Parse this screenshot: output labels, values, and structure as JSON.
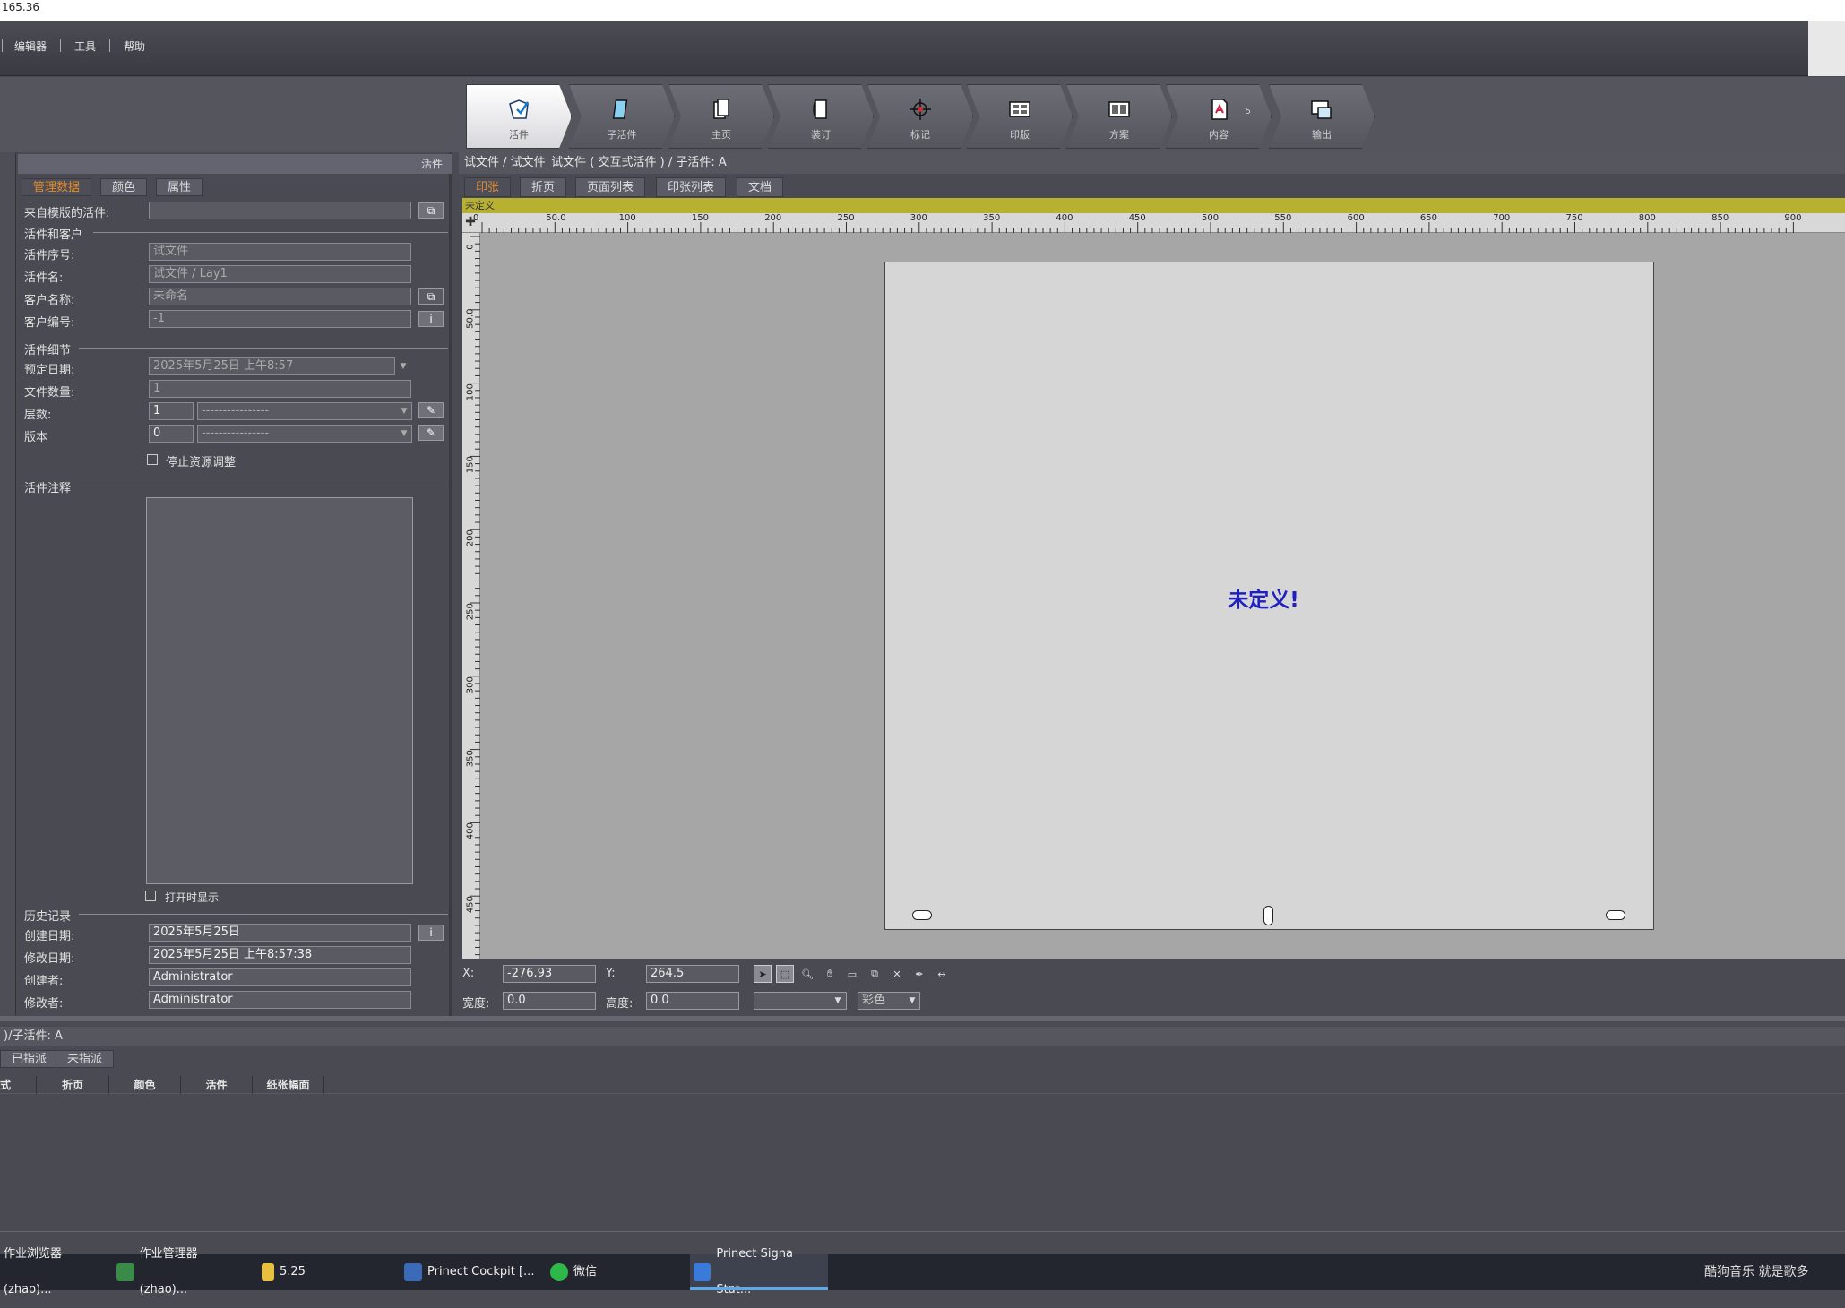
{
  "titlebar": {
    "text": "165.36"
  },
  "menu": {
    "items": [
      "编辑器",
      "工具",
      "帮助"
    ]
  },
  "toolbar": {
    "tabs": [
      {
        "label": "活件",
        "icon": "job-icon",
        "active": true
      },
      {
        "label": "子活件",
        "icon": "subjob-icon"
      },
      {
        "label": "主页",
        "icon": "master-pages-icon"
      },
      {
        "label": "装订",
        "icon": "binding-icon"
      },
      {
        "label": "标记",
        "icon": "marks-icon"
      },
      {
        "label": "印版",
        "icon": "plate-icon"
      },
      {
        "label": "方案",
        "icon": "layout-icon"
      },
      {
        "label": "内容",
        "icon": "content-icon",
        "badge": "5"
      },
      {
        "label": "输出",
        "icon": "output-icon"
      }
    ]
  },
  "left_panel": {
    "header": "活件",
    "tabs": [
      "管理数据",
      "颜色",
      "属性"
    ],
    "from_template_label": "来自模版的活件:",
    "from_template_value": "",
    "section_job_customer": "活件和客户",
    "job_no_label": "活件序号:",
    "job_no_value": "试文件",
    "job_name_label": "活件名:",
    "job_name_value": "试文件 / Lay1",
    "customer_name_label": "客户名称:",
    "customer_name_value": "未命名",
    "customer_no_label": "客户编号:",
    "customer_no_value": "-1",
    "section_details": "活件细节",
    "due_date_label": "预定日期:",
    "due_date_value": "2025年5月25日 上午8:57",
    "file_count_label": "文件数量:",
    "file_count_value": "1",
    "layers_label": "层数:",
    "layers_value": "1",
    "layers_select": "----------------",
    "version_label": "版本",
    "version_value": "0",
    "version_select": "----------------",
    "stop_resource_label": "停止资源调整",
    "section_notes": "活件注释",
    "show_on_open_label": "打开时显示",
    "section_history": "历史记录",
    "created_label": "创建日期:",
    "created_value": "2025年5月25日",
    "modified_label": "修改日期:",
    "modified_value": "2025年5月25日   上午8:57:38",
    "creator_label": "创建者:",
    "creator_value": "Administrator",
    "modifier_label": "修改者:",
    "modifier_value": "Administrator",
    "info_btn": "i"
  },
  "main": {
    "breadcrumb": "试文件 / 试文件_试文件 ( 交互式活件 ) / 子活件: A",
    "tabs": [
      "印张",
      "折页",
      "页面列表",
      "印张列表",
      "文档"
    ],
    "yellow_label": "未定义",
    "ruler_h": [
      "0",
      "50.0",
      "100",
      "150",
      "200",
      "250",
      "300",
      "350",
      "400",
      "450",
      "500",
      "550",
      "600",
      "650",
      "700",
      "750",
      "800",
      "850",
      "900"
    ],
    "ruler_v": [
      "0",
      "-50.0",
      "-100",
      "-150",
      "-200",
      "-250",
      "-300",
      "-350",
      "-400",
      "-450"
    ],
    "sheet_text": "未定义!",
    "x_label": "X:",
    "x_value": "-276.93",
    "y_label": "Y:",
    "y_value": "264.5",
    "width_label": "宽度:",
    "width_value": "0.0",
    "height_label": "高度:",
    "height_value": "0.0",
    "color_select": "彩色"
  },
  "bottom": {
    "breadcrumb": ")/子活件: A",
    "tabs": [
      "已指派",
      "未指派"
    ],
    "columns": [
      "式",
      "折页",
      "颜色",
      "活件",
      "纸张幅面"
    ]
  },
  "taskbar": {
    "items": [
      {
        "label": "作业浏览器 (zhao)...",
        "color": "#4a7ac8"
      },
      {
        "label": "作业管理器 (zhao)...",
        "color": "#3a8a4a"
      },
      {
        "label": "5.25",
        "color": "#e8c040"
      },
      {
        "label": "Prinect Cockpit [...",
        "color": "#3a6ab8"
      },
      {
        "label": "微信",
        "color": "#2fb84a"
      },
      {
        "label": "Prinect Signa Stat...",
        "color": "#3a7ad8",
        "active": true
      }
    ],
    "tray_text": "酷狗音乐 就是歌多"
  }
}
